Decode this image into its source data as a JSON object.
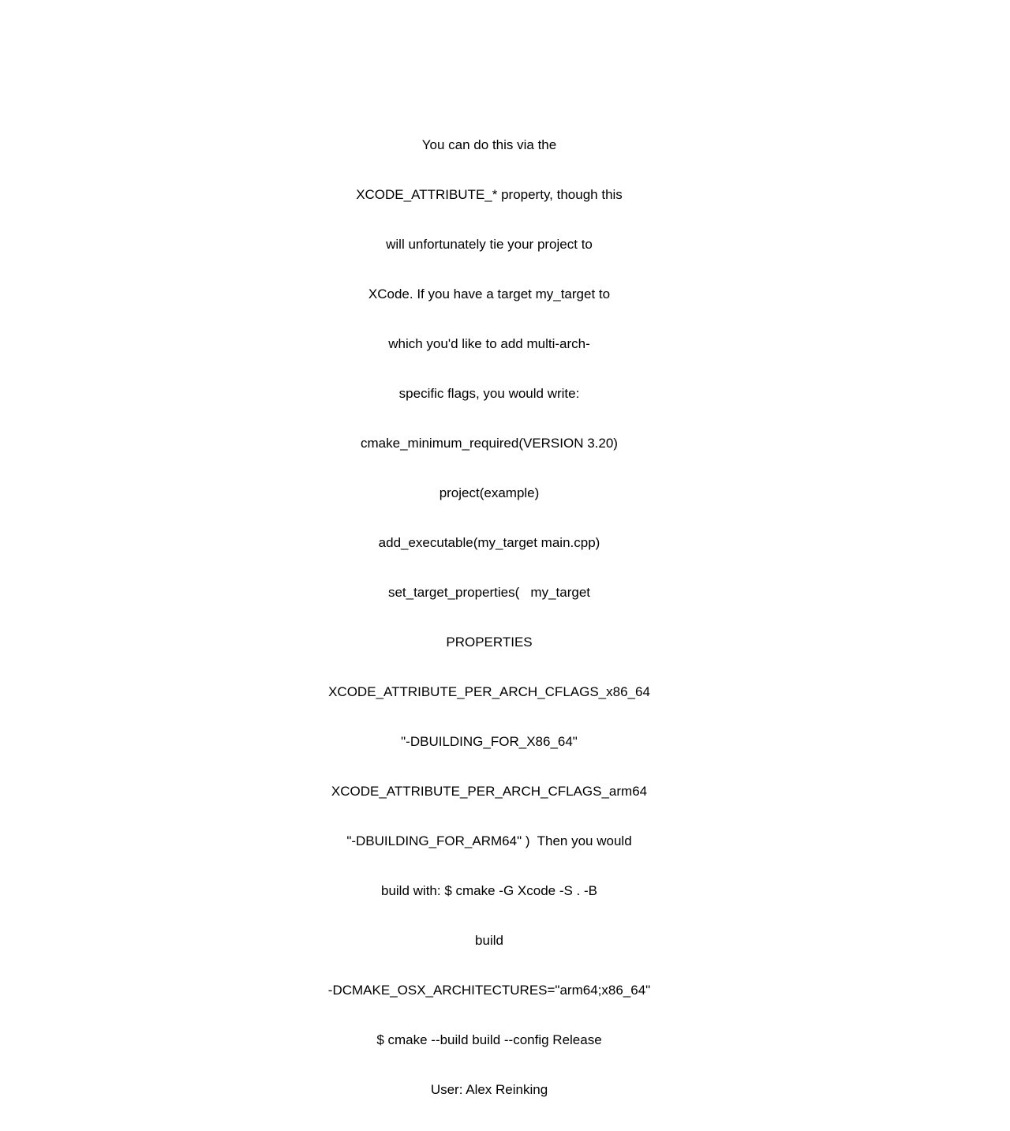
{
  "page": {
    "background_color": "#ffffff",
    "text_color": "#000000",
    "alignment": "center"
  },
  "content": {
    "lines": [
      "You can do this via the",
      "XCODE_ATTRIBUTE_* property, though this",
      "will unfortunately tie your project to",
      "XCode. If you have a target my_target to",
      "which you'd like to add multi-arch-",
      "specific flags, you would write:",
      "cmake_minimum_required(VERSION 3.20)",
      "project(example)",
      "add_executable(my_target main.cpp)",
      "set_target_properties(   my_target",
      "PROPERTIES",
      "XCODE_ATTRIBUTE_PER_ARCH_CFLAGS_x86_64",
      "\"-DBUILDING_FOR_X86_64\"",
      "XCODE_ATTRIBUTE_PER_ARCH_CFLAGS_arm64",
      "\"-DBUILDING_FOR_ARM64\" )  Then you would",
      "build with: $ cmake -G Xcode -S . -B",
      "build",
      "-DCMAKE_OSX_ARCHITECTURES=\"arm64;x86_64\"",
      "$ cmake --build build --config Release",
      "User: Alex Reinking"
    ],
    "attribution": "User: Alex Reinking"
  }
}
